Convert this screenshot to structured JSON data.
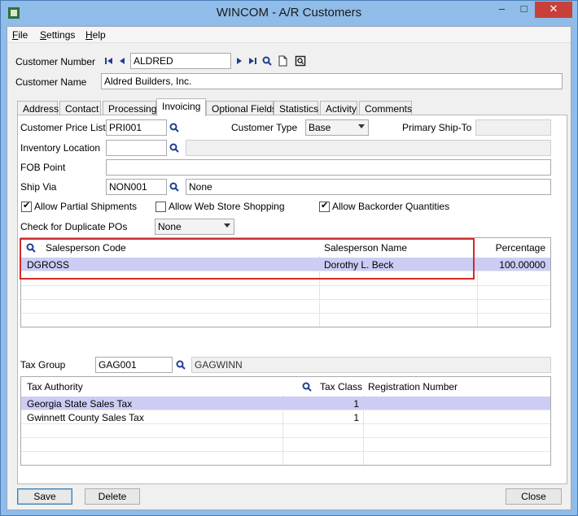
{
  "window": {
    "title": "WINCOM - A/R Customers"
  },
  "menu": [
    {
      "key": "F",
      "rest": "ile"
    },
    {
      "key": "S",
      "rest": "ettings"
    },
    {
      "key": "H",
      "rest": "elp"
    }
  ],
  "customer": {
    "number_label": "Customer Number",
    "number_value": "ALDRED",
    "name_label": "Customer Name",
    "name_value": "Aldred Builders, Inc."
  },
  "tabs": [
    "Address",
    "Contact",
    "Processing",
    "Invoicing",
    "Optional Fields",
    "Statistics",
    "Activity",
    "Comments"
  ],
  "active_tab": "Invoicing",
  "invoicing": {
    "price_list_label": "Customer Price List",
    "price_list_value": "PRI001",
    "customer_type_label": "Customer Type",
    "customer_type_value": "Base",
    "primary_ship_to_label": "Primary Ship-To",
    "primary_ship_to_value": "",
    "inventory_location_label": "Inventory Location",
    "inventory_location_value": "",
    "inventory_location_desc": "",
    "fob_label": "FOB Point",
    "fob_value": "",
    "ship_via_label": "Ship Via",
    "ship_via_code": "NON001",
    "ship_via_desc": "None",
    "allow_partial_label": "Allow Partial Shipments",
    "allow_partial_checked": true,
    "allow_web_label": "Allow Web Store Shopping",
    "allow_web_checked": false,
    "allow_backorder_label": "Allow Backorder Quantities",
    "allow_backorder_checked": true,
    "dup_po_label": "Check for Duplicate POs",
    "dup_po_value": "None"
  },
  "salesperson_grid": {
    "columns": [
      "Salesperson Code",
      "Salesperson Name",
      "Percentage"
    ],
    "rows": [
      {
        "code": "DGROSS",
        "name": "Dorothy L. Beck",
        "percentage": "100.00000"
      }
    ]
  },
  "tax": {
    "group_label": "Tax Group",
    "group_code": "GAG001",
    "group_desc": "GAGWINN",
    "columns": [
      "Tax Authority",
      "Tax Class",
      "Registration Number"
    ],
    "rows": [
      {
        "authority": "Georgia State Sales Tax",
        "class": "1",
        "registration": ""
      },
      {
        "authority": "Gwinnett County Sales Tax",
        "class": "1",
        "registration": ""
      }
    ]
  },
  "buttons": {
    "save": "Save",
    "delete": "Delete",
    "close": "Close"
  },
  "colors": {
    "selected_row": "#ccccf5",
    "highlight_box": "#d42a2a",
    "close_button": "#c7413a"
  }
}
